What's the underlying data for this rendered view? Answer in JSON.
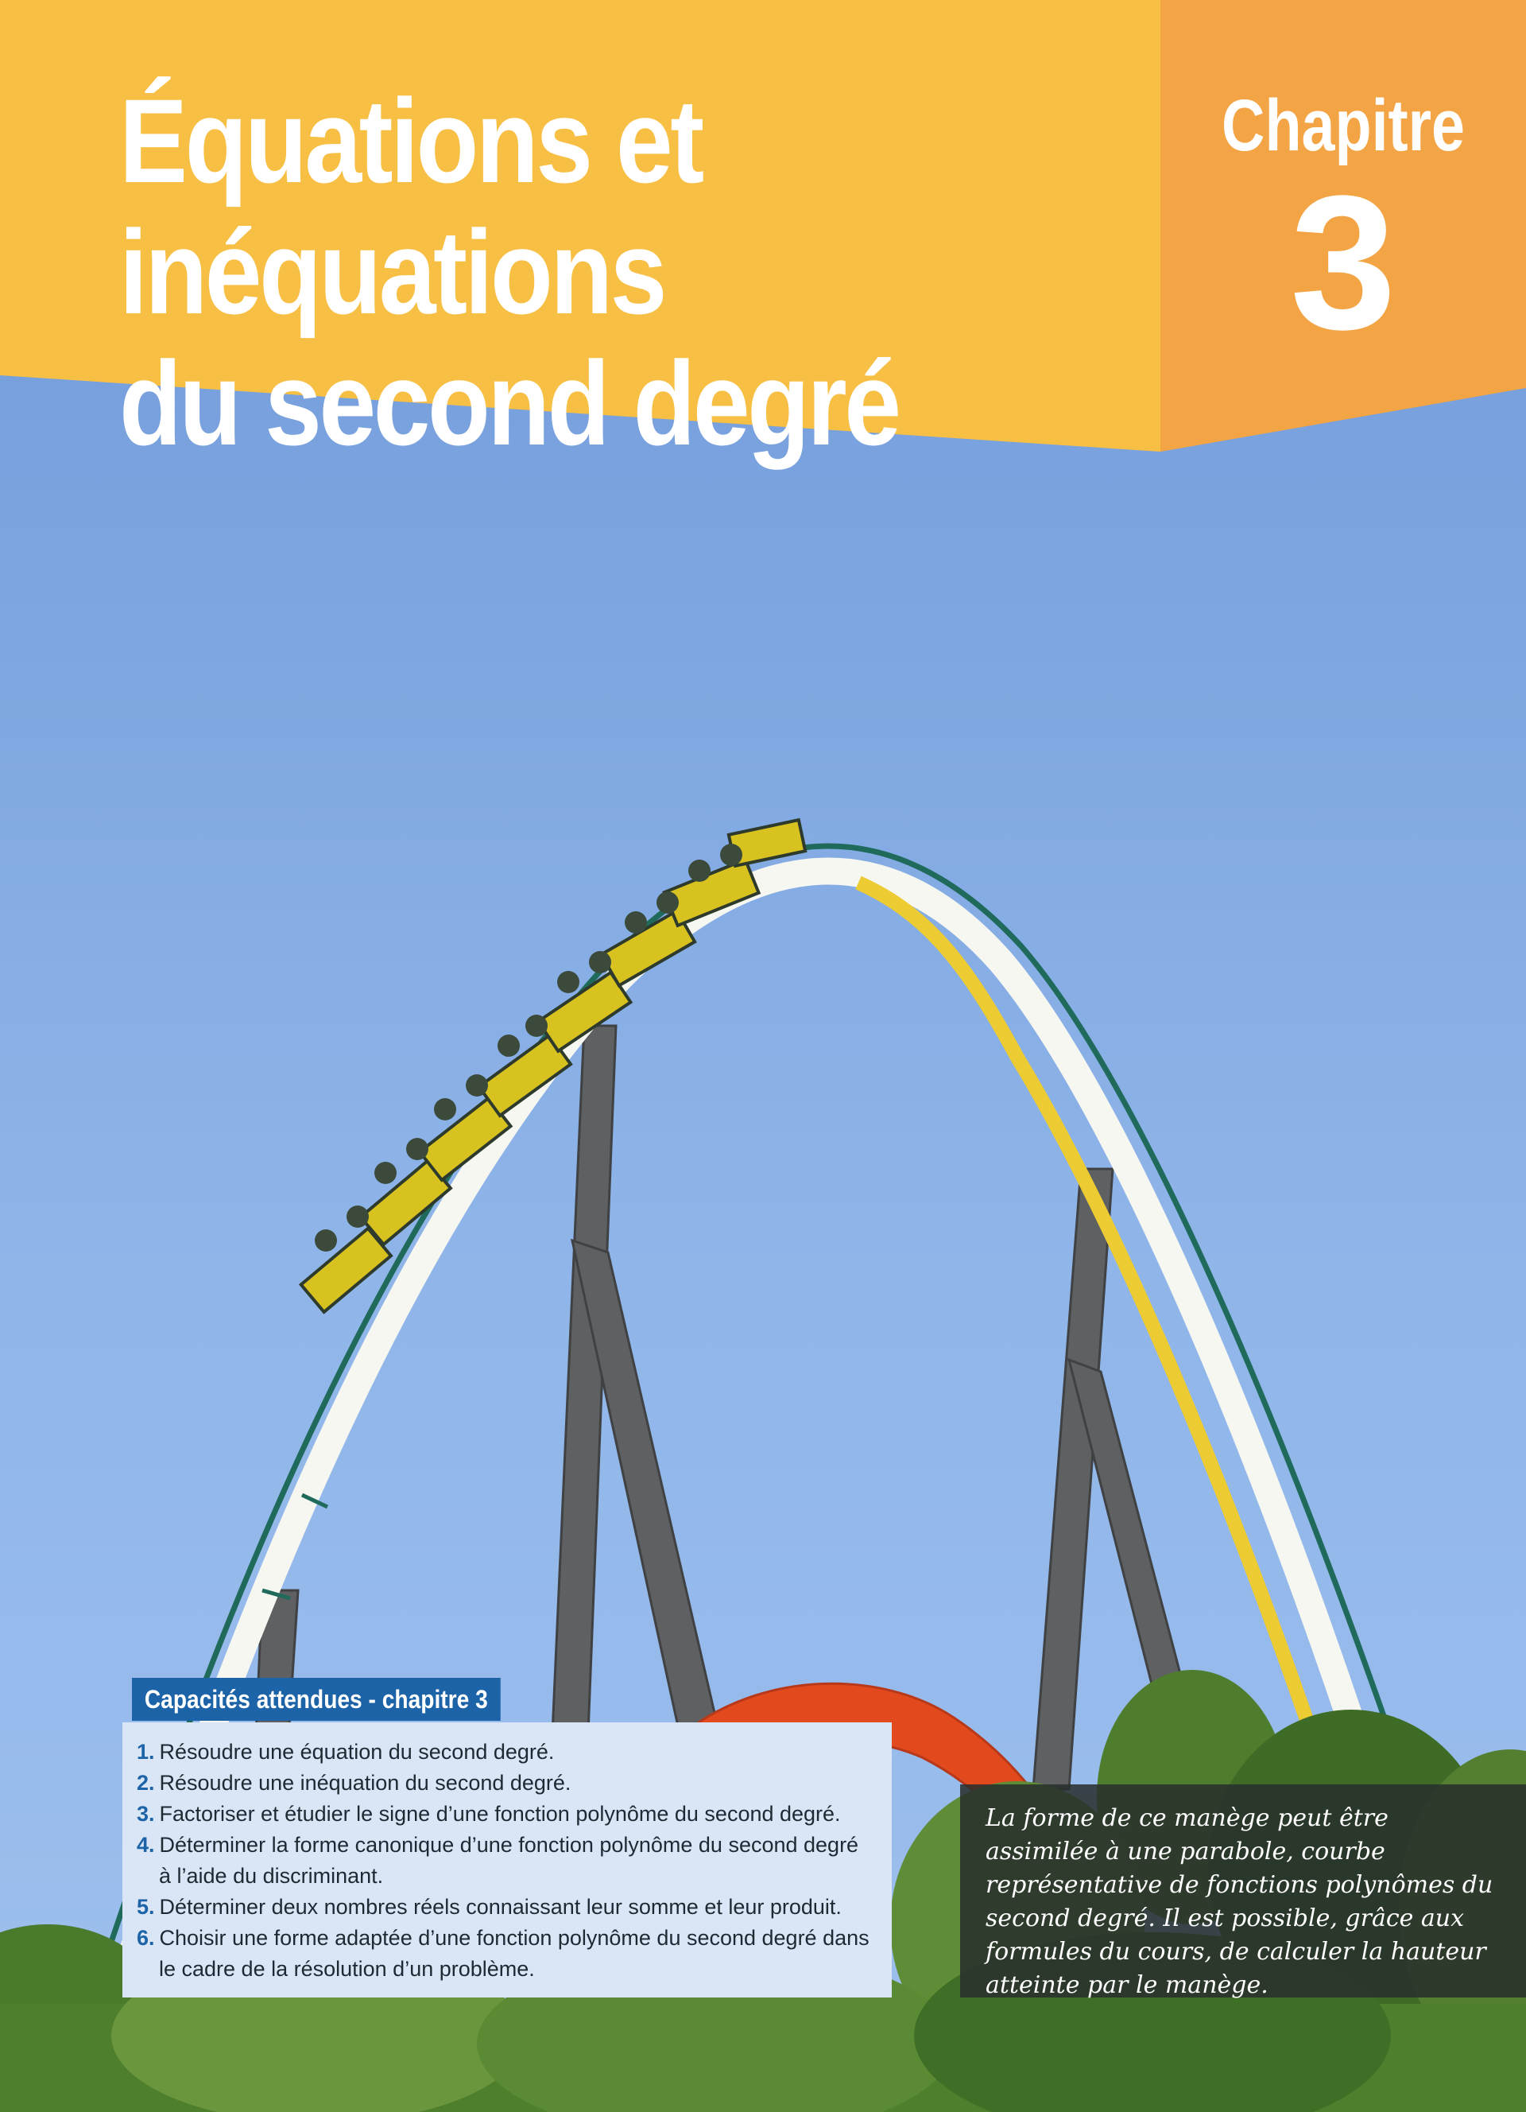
{
  "header": {
    "title_line_1": "Équations et inéquations",
    "title_line_2": "du second degré",
    "chapter_label": "Chapitre",
    "chapter_number": "3"
  },
  "colors": {
    "banner_yellow": "#f8bf45",
    "banner_orange": "#f3a445",
    "capacites_blue": "#1d63a8",
    "capacites_bg": "#dae6f5",
    "sky_blue": "#86aee6"
  },
  "capacites": {
    "heading": "Capacités attendues - chapitre 3",
    "items": [
      {
        "num": "1.",
        "text": "Résoudre une équation du second degré."
      },
      {
        "num": "2.",
        "text": "Résoudre une inéquation du second degré."
      },
      {
        "num": "3.",
        "text": "Factoriser et étudier le signe d’une fonction polynôme du second degré."
      },
      {
        "num": "4.",
        "text": "Déterminer la forme canonique d’une fonction polynôme du second degré à l’aide du discriminant."
      },
      {
        "num": "5.",
        "text": "Déterminer deux nombres réels connaissant leur somme et leur produit."
      },
      {
        "num": "6.",
        "text": "Choisir une forme adaptée d’une fonction polynôme du second degré dans le cadre de la résolution d’un problème."
      }
    ]
  },
  "caption": {
    "text": "La forme de ce manège peut être assimilée à une parabole, courbe représentative de fonctions polynômes du second degré. Il est possible, grâce aux formules du cours, de calculer la hauteur atteinte par le manège."
  },
  "photo": {
    "subject": "roller-coaster-parabola-photo"
  }
}
